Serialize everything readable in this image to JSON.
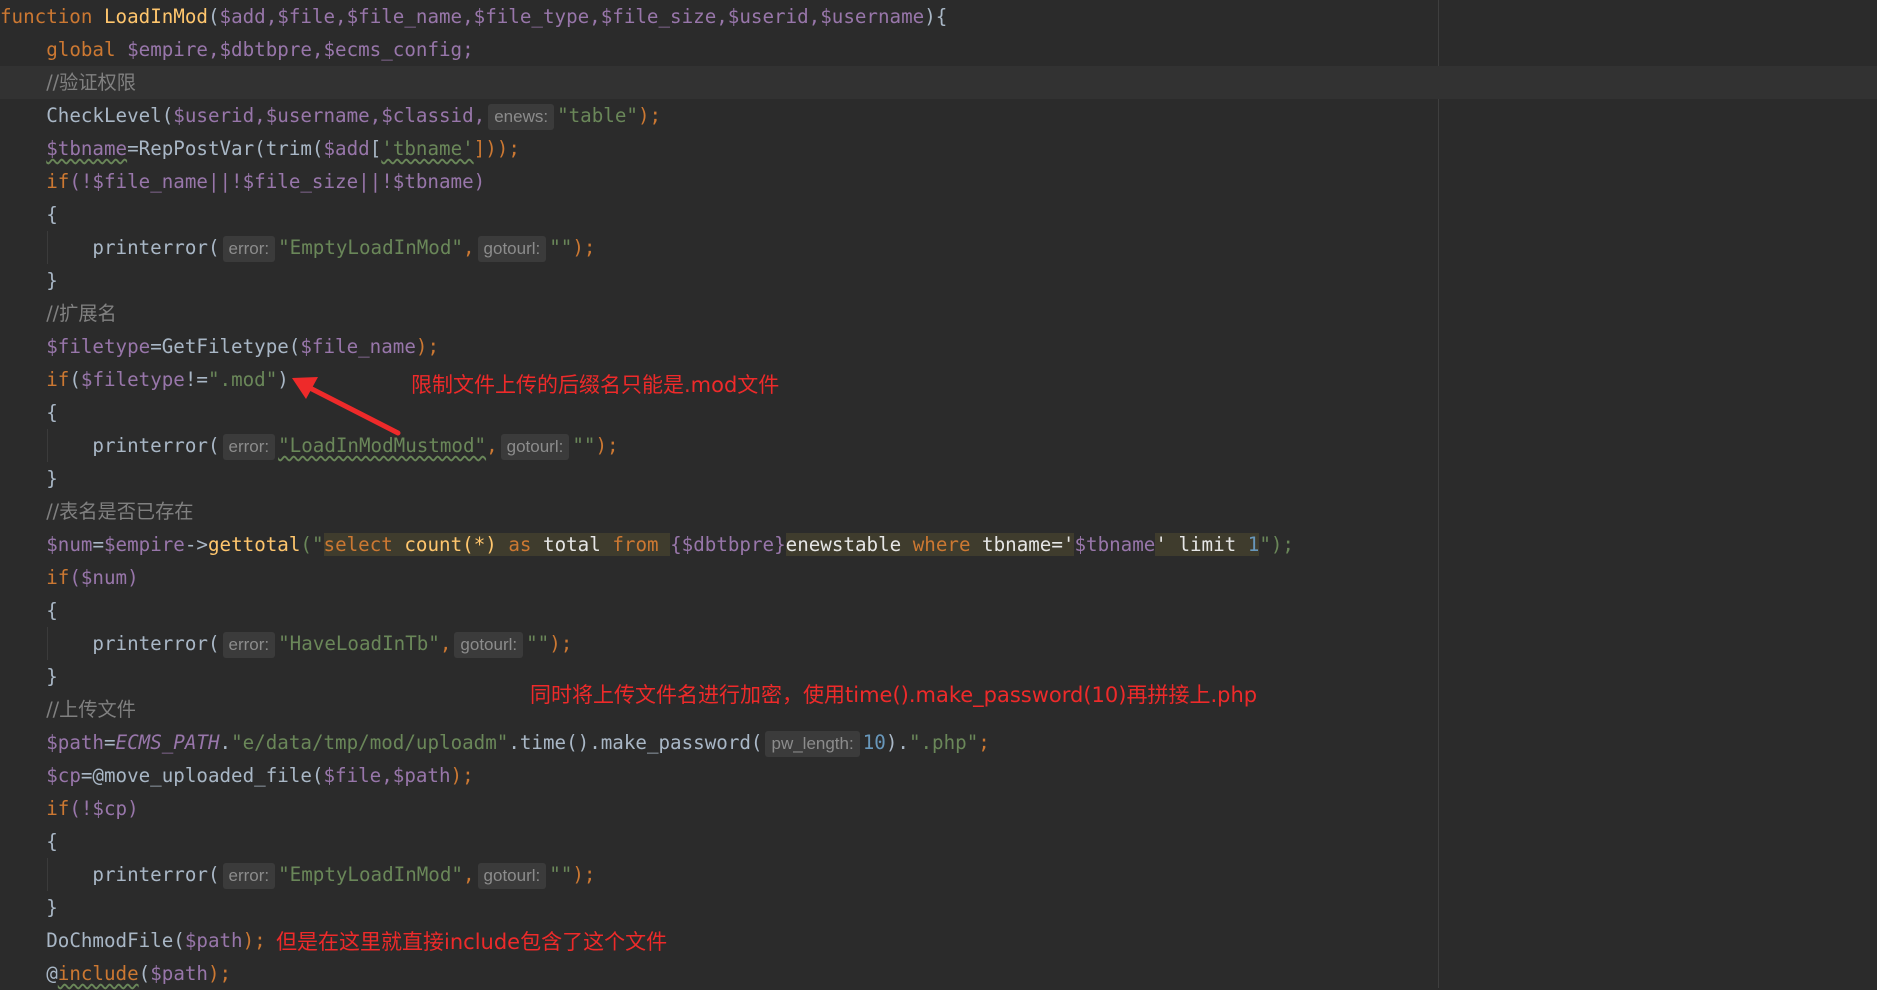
{
  "code": {
    "l1": {
      "kw": "function",
      "name": "LoadInMod",
      "p_open": "(",
      "params": "$add,$file,$file_name,$file_type,$file_size,$userid,$username",
      "p_close": "){"
    },
    "l2": {
      "kw": "global",
      "vars": "$empire,$dbtbpre,$ecms_config;"
    },
    "l3": {
      "comment": "//验证权限"
    },
    "l4": {
      "call": "CheckLevel(",
      "args": "$userid,$username,$classid,",
      "hint": "enews:",
      "str": "\"table\"",
      "end": ");"
    },
    "l5": {
      "var": "$tbname",
      "mid": "=RepPostVar(trim(",
      "var2": "$add",
      "br": "[",
      "str": "'tbname'",
      "end": "]));"
    },
    "l6": {
      "kw": "if",
      "text": "(!$file_name||!$file_size||!$tbname)"
    },
    "l7": {
      "brace": "{"
    },
    "l8": {
      "call": "printerror(",
      "hint1": "error:",
      "str": "\"EmptyLoadInMod\"",
      "comma": ",",
      "hint2": "gotourl:",
      "str2": "\"\"",
      "end": ");"
    },
    "l9": {
      "brace": "}"
    },
    "l10": {
      "comment": "//扩展名"
    },
    "l11": {
      "var": "$filetype",
      "mid": "=GetFiletype(",
      "var2": "$file_name",
      "end": ");"
    },
    "l12": {
      "kw": "if",
      "open": "(",
      "var": "$filetype",
      "op": "!=",
      "str": "\".mod\"",
      "end": ")"
    },
    "l13": {
      "brace": "{"
    },
    "l14": {
      "call": "printerror(",
      "hint1": "error:",
      "str": "\"LoadInModMustmod\"",
      "comma": ",",
      "hint2": "gotourl:",
      "str2": "\"\"",
      "end": ");"
    },
    "l15": {
      "brace": "}"
    },
    "l16": {
      "comment": "//表名是否已存在"
    },
    "l17": {
      "var": "$num",
      "eq": "=",
      "var2": "$empire",
      "arrow": "->",
      "fn": "gettotal",
      "open": "(\"",
      "s1": "select",
      "s2": " count(*) ",
      "s3": "as",
      "s4": " total ",
      "s5": "from",
      "s6": " ",
      "s7": "{$dbtbpre}",
      "s8": "enewstable ",
      "s9": "where",
      "s10": " tbname='",
      "s11": "$tbname",
      "s12": "' limit ",
      "s13": "1",
      "end": "\");"
    },
    "l18": {
      "kw": "if",
      "text": "($num)"
    },
    "l19": {
      "brace": "{"
    },
    "l20": {
      "call": "printerror(",
      "hint1": "error:",
      "str": "\"HaveLoadInTb\"",
      "comma": ",",
      "hint2": "gotourl:",
      "str2": "\"\"",
      "end": ");"
    },
    "l21": {
      "brace": "}"
    },
    "l22": {
      "comment": "//上传文件"
    },
    "l23": {
      "var": "$path",
      "eq": "=",
      "const": "ECMS_PATH",
      "dot": ".",
      "str": "\"e/data/tmp/mod/uploadm\"",
      "mid": ".time().make_password(",
      "hint": "pw_length:",
      "num": "10",
      "mid2": ").",
      "str2": "\".php\"",
      "end": ";"
    },
    "l24": {
      "var": "$cp",
      "mid": "=@move_uploaded_file(",
      "args": "$file,$path",
      "end": ");"
    },
    "l25": {
      "kw": "if",
      "text": "(!$cp)"
    },
    "l26": {
      "brace": "{"
    },
    "l27": {
      "call": "printerror(",
      "hint1": "error:",
      "str": "\"EmptyLoadInMod\"",
      "comma": ",",
      "hint2": "gotourl:",
      "str2": "\"\"",
      "end": ");"
    },
    "l28": {
      "brace": "}"
    },
    "l29": {
      "call": "DoChmodFile(",
      "var": "$path",
      "end": ");"
    },
    "l30": {
      "at": "@",
      "kw": "include",
      "open": "(",
      "var": "$path",
      "end": ");"
    }
  },
  "annotations": {
    "a1": "限制文件上传的后缀名只能是.mod文件",
    "a2": "同时将上传文件名进行加密，使用time().make_password(10)再拼接上.php",
    "a3": "但是在这里就直接include包含了这个文件"
  },
  "colors": {
    "background": "#2b2b2b",
    "keyword": "#cc7832",
    "string": "#6a8759",
    "variable": "#9876aa",
    "annotation": "#ee2a2a"
  }
}
